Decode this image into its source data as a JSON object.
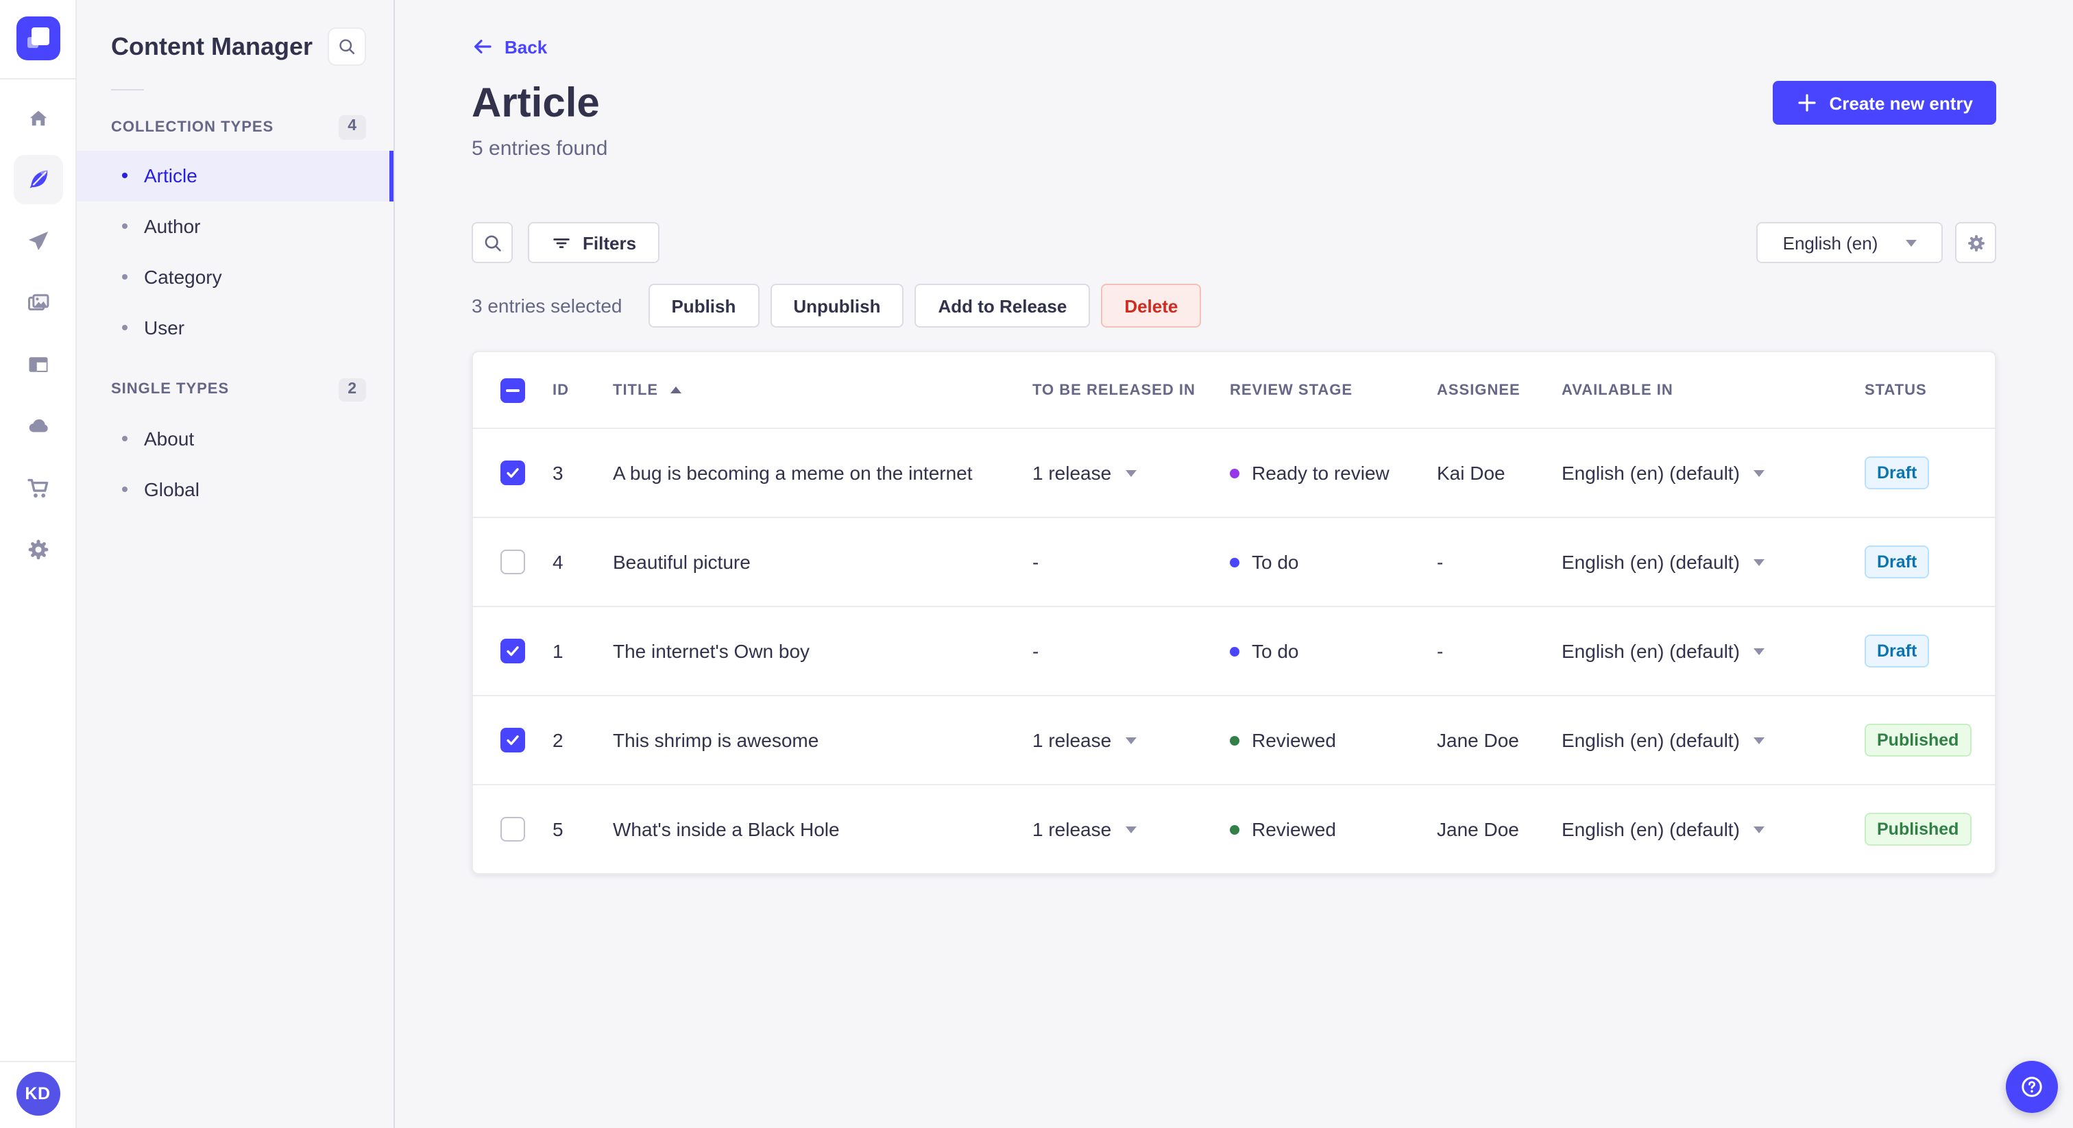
{
  "colors": {
    "primary": "#4945ff",
    "primary_dark": "#271fe0",
    "active_item_bg": "#ededfc",
    "danger_text": "#d02b20",
    "danger_bg": "#fcecea",
    "draft_text": "#0c75af",
    "draft_bg": "#eaf5ff",
    "published_text": "#328048",
    "published_bg": "#eafbe7",
    "stage_dot_todo": "#4945ff",
    "stage_dot_ready_to_review": "#9736e8",
    "stage_dot_reviewed": "#328048"
  },
  "rail": {
    "logo_icon": "strapi-logo",
    "icons": [
      "home-icon",
      "content-manager-feather-icon",
      "releases-paper-plane-icon",
      "media-library-pictures-icon",
      "content-type-builder-layout-icon",
      "cloud-icon",
      "marketplace-cart-icon",
      "settings-gear-icon"
    ],
    "active_icon": "content-manager-feather-icon",
    "avatar_initials": "KD"
  },
  "subnav": {
    "title": "Content Manager",
    "search_icon": "search-icon",
    "sections": [
      {
        "label": "COLLECTION TYPES",
        "count": "4",
        "items": [
          {
            "label": "Article",
            "active": true
          },
          {
            "label": "Author",
            "active": false
          },
          {
            "label": "Category",
            "active": false
          },
          {
            "label": "User",
            "active": false
          }
        ]
      },
      {
        "label": "SINGLE TYPES",
        "count": "2",
        "items": [
          {
            "label": "About",
            "active": false
          },
          {
            "label": "Global",
            "active": false
          }
        ]
      }
    ]
  },
  "header": {
    "back": "Back",
    "title": "Article",
    "subtitle": "5 entries found",
    "create_button": "Create new entry"
  },
  "toolbar": {
    "filters": "Filters",
    "locale": "English (en)"
  },
  "selection": {
    "summary": "3 entries selected",
    "actions": {
      "publish": "Publish",
      "unpublish": "Unpublish",
      "add_to_release": "Add to Release",
      "delete": "Delete"
    }
  },
  "table": {
    "header_checkbox_state": "indeterminate",
    "sort": {
      "column": "TITLE",
      "direction": "asc"
    },
    "columns": {
      "id": "ID",
      "title": "TITLE",
      "release": "TO BE RELEASED IN",
      "stage": "REVIEW STAGE",
      "assignee": "ASSIGNEE",
      "available": "AVAILABLE IN",
      "status": "STATUS"
    },
    "rows": [
      {
        "checked": true,
        "id": "3",
        "title": "A bug is becoming a meme on the internet",
        "release": "1 release",
        "stage": "Ready to review",
        "assignee": "Kai Doe",
        "locale": "English (en) (default)",
        "status": "Draft"
      },
      {
        "checked": false,
        "id": "4",
        "title": "Beautiful picture",
        "release": "-",
        "stage": "To do",
        "assignee": "-",
        "locale": "English (en) (default)",
        "status": "Draft"
      },
      {
        "checked": true,
        "id": "1",
        "title": "The internet's Own boy",
        "release": "-",
        "stage": "To do",
        "assignee": "-",
        "locale": "English (en) (default)",
        "status": "Draft"
      },
      {
        "checked": true,
        "id": "2",
        "title": "This shrimp is awesome",
        "release": "1 release",
        "stage": "Reviewed",
        "assignee": "Jane Doe",
        "locale": "English (en) (default)",
        "status": "Published"
      },
      {
        "checked": false,
        "id": "5",
        "title": "What's inside a Black Hole",
        "release": "1 release",
        "stage": "Reviewed",
        "assignee": "Jane Doe",
        "locale": "English (en) (default)",
        "status": "Published"
      }
    ]
  },
  "fab": {
    "icon": "help-icon"
  }
}
